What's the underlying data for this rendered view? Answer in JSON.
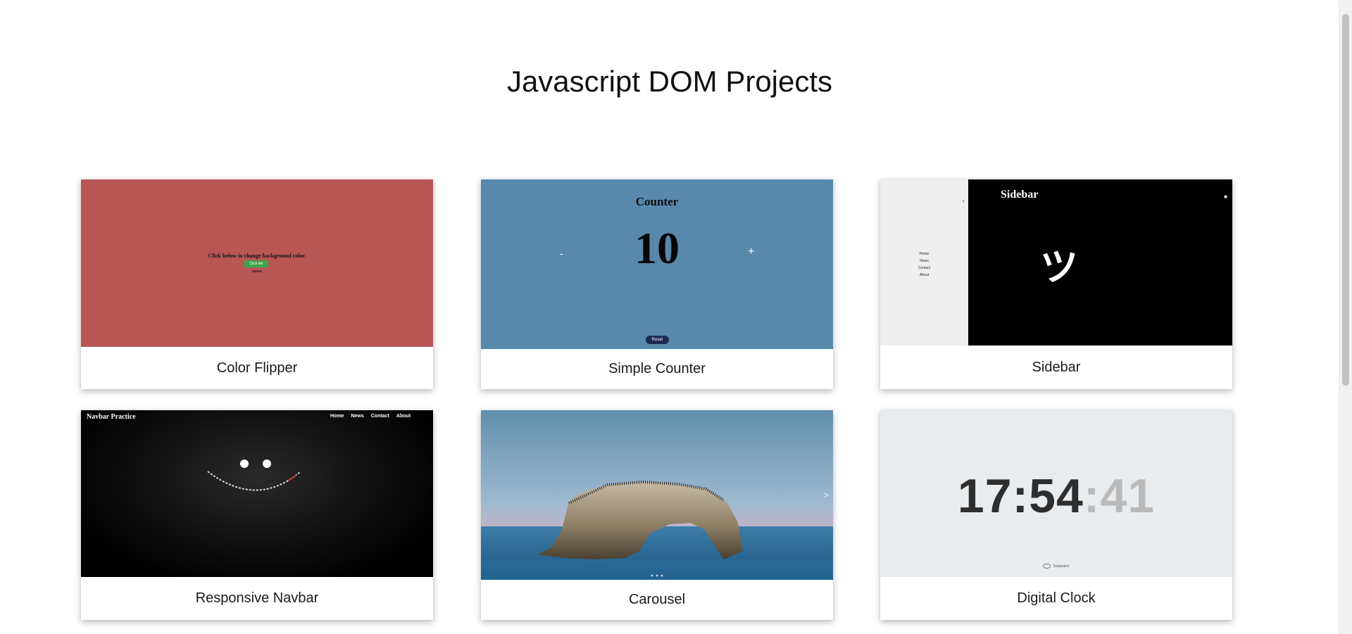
{
  "page": {
    "title": "Javascript DOM Projects"
  },
  "projects": [
    {
      "name": "Color Flipper",
      "preview": {
        "text": "Click below to change background color.",
        "button": "Click Me",
        "color_label": "#b85656",
        "bg": "#b85656"
      }
    },
    {
      "name": "Simple Counter",
      "preview": {
        "title": "Counter",
        "value": "10",
        "minus": "-",
        "plus": "+",
        "reset": "Reset",
        "bg": "#5889ad"
      }
    },
    {
      "name": "Sidebar",
      "preview": {
        "title": "Sidebar",
        "glyph": "ツ",
        "arrow": "‹",
        "menu": "■",
        "links": [
          "Home",
          "News",
          "Contact",
          "About"
        ]
      }
    },
    {
      "name": "Responsive Navbar",
      "preview": {
        "brand": "Navbar Practice",
        "links": [
          "Home",
          "News",
          "Contact",
          "About"
        ]
      }
    },
    {
      "name": "Carousel",
      "preview": {
        "next": ">"
      }
    },
    {
      "name": "Digital Clock",
      "preview": {
        "hours_minutes": "17:54",
        "seconds": ":41",
        "badge": "Stopwatch"
      }
    }
  ]
}
